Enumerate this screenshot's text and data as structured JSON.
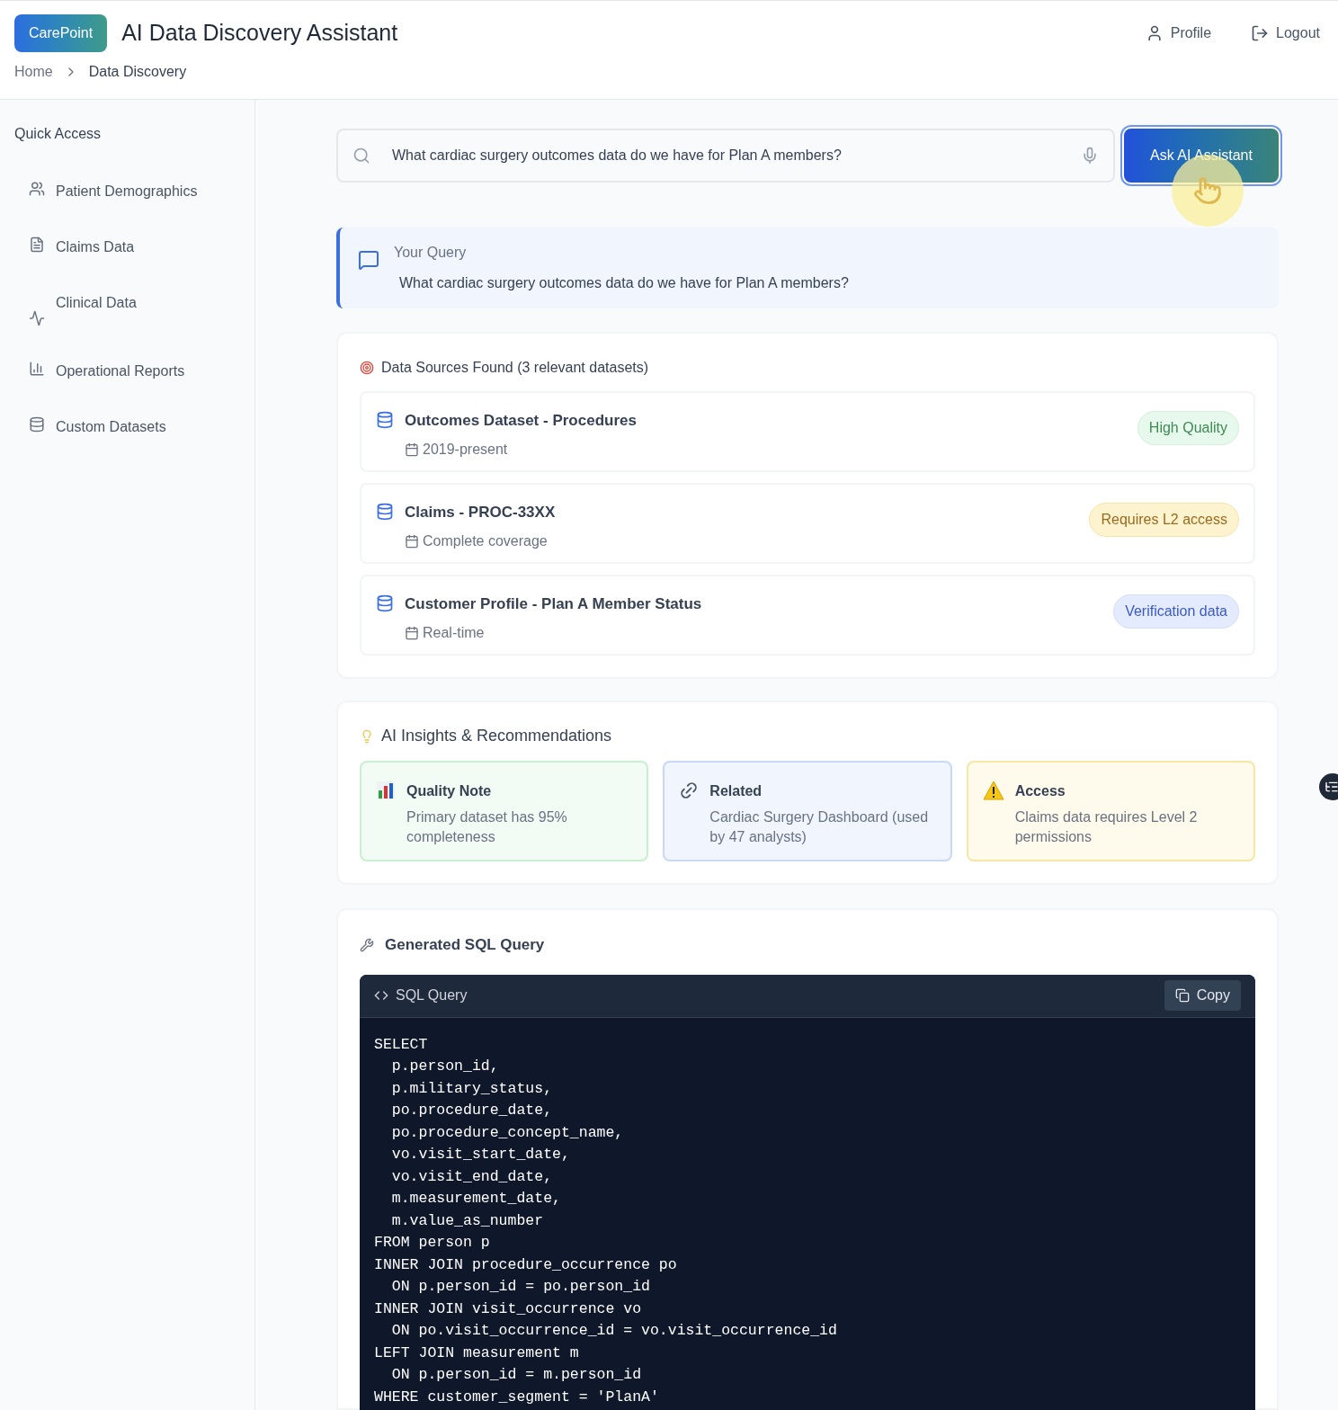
{
  "header": {
    "logo": "CarePoint",
    "title": "AI Data Discovery Assistant",
    "nav": [
      "Profile",
      "Logout"
    ]
  },
  "breadcrumb": {
    "items": [
      "Home",
      "Data Discovery"
    ]
  },
  "sidebar": {
    "title": "Quick Access",
    "items": [
      {
        "label": "Patient Demographics",
        "kind": "users"
      },
      {
        "label": "Claims Data",
        "kind": "file"
      },
      {
        "label": "Clinical Data",
        "kind": "activity"
      },
      {
        "label": "Operational Reports",
        "kind": "chart"
      },
      {
        "label": "Custom Datasets",
        "kind": "database"
      }
    ]
  },
  "search": {
    "value": "What cardiac surgery outcomes data do we have for Plan A members?",
    "button": "Ask AI Assistant"
  },
  "query": {
    "label": "Your Query",
    "text": "What cardiac surgery outcomes data do we have for Plan A members?"
  },
  "sources": {
    "title": "Data Sources Found (3 relevant datasets)",
    "items": [
      {
        "name": "Outcomes Dataset - Procedures",
        "range": "2019-present",
        "badge": "High Quality",
        "kind": "success"
      },
      {
        "name": "Claims - PROC-33XX",
        "range": "Complete coverage",
        "badge": "Requires L2 access",
        "kind": "warning"
      },
      {
        "name": "Customer Profile - Plan A Member Status",
        "range": "Real-time",
        "badge": "Verification data",
        "kind": "info"
      }
    ]
  },
  "insights": {
    "title": "AI Insights & Recommendations",
    "items": [
      {
        "kind": "quality",
        "title": "Quality Note",
        "text": "Primary dataset has 95% completeness"
      },
      {
        "kind": "related",
        "title": "Related",
        "text": "Cardiac Surgery Dashboard (used by 47 analysts)"
      },
      {
        "kind": "access",
        "title": "Access",
        "text": "Claims data requires Level 2 permissions"
      }
    ]
  },
  "sql": {
    "title": "Generated SQL Query",
    "label": "SQL Query",
    "copy": "Copy",
    "lines": [
      "SELECT",
      "  p.person_id,",
      "  p.military_status,",
      "  po.procedure_date,",
      "  po.procedure_concept_name,",
      "  vo.visit_start_date,",
      "  vo.visit_end_date,",
      "  m.measurement_date,",
      "  m.value_as_number",
      "FROM person p",
      "INNER JOIN procedure_occurrence po",
      "  ON p.person_id = po.person_id",
      "INNER JOIN visit_occurrence vo",
      "  ON po.visit_occurrence_id = vo.visit_occurrence_id",
      "LEFT JOIN measurement m",
      "  ON p.person_id = m.person_id",
      "WHERE customer_segment = 'PlanA'"
    ]
  }
}
